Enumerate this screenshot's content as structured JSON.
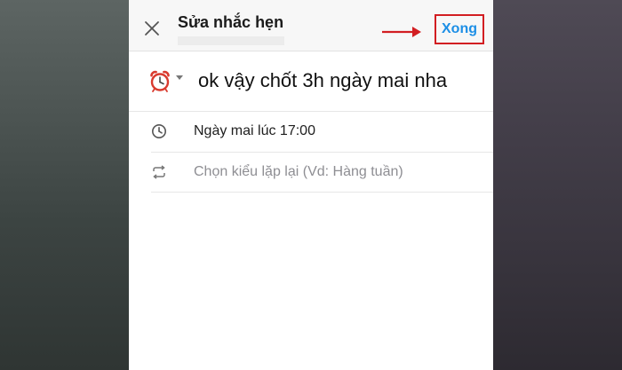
{
  "header": {
    "title": "Sửa nhắc hẹn",
    "done_label": "Xong"
  },
  "reminder": {
    "message": "ok vậy chốt 3h ngày mai nha",
    "time_text": "Ngày mai lúc 17:00",
    "repeat_placeholder": "Chọn kiểu lặp lại (Vd: Hàng tuần)"
  },
  "colors": {
    "accent": "#1d8fe6",
    "highlight_border": "#d21e22",
    "arrow": "#d21e22"
  },
  "icons": {
    "close": "close-icon",
    "alarm": "alarm-clock-icon",
    "caret": "caret-down-icon",
    "time": "clock-icon",
    "repeat": "repeat-icon",
    "annotation": "arrow-right-icon"
  }
}
